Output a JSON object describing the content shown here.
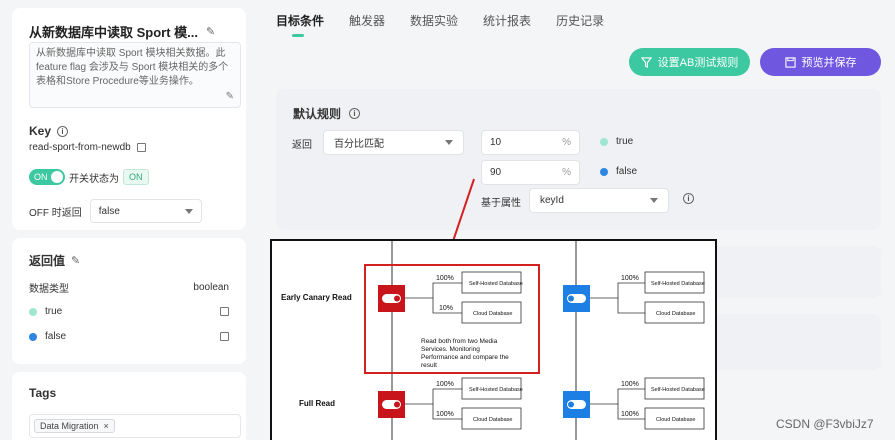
{
  "flag": {
    "title": "从新数据库中读取 Sport 模...",
    "description": "从新数据库中读取 Sport 模块相关数据。此 feature flag 会涉及与 Sport 模块相关的多个表格和Store Procedure等业务操作。",
    "key_label": "Key",
    "key_value": "read-sport-from-newdb",
    "switch_label": "ON",
    "switch_state_text": "开关状态为",
    "switch_state_tag": "ON",
    "off_return_label": "OFF 时返回",
    "off_return_value": "false"
  },
  "return_values": {
    "title": "返回值",
    "type_label": "数据类型",
    "type_value": "boolean",
    "items": [
      {
        "label": "true",
        "color": "#9fe6d0"
      },
      {
        "label": "false",
        "color": "#2f86e0"
      }
    ]
  },
  "tags": {
    "title": "Tags",
    "items": [
      "Data Migration"
    ]
  },
  "tabs": [
    "目标条件",
    "触发器",
    "数据实验",
    "统计报表",
    "历史记录"
  ],
  "buttons": {
    "ab": "设置AB测试规则",
    "save": "预览并保存"
  },
  "default_rule": {
    "title": "默认规则",
    "return_label": "返回",
    "mode": "百分比匹配",
    "pct_true": "10",
    "pct_false": "90",
    "pct_symbol": "%",
    "true_label": "true",
    "false_label": "false",
    "attr_label": "基于属性",
    "attr_value": "keyId"
  },
  "diagram": {
    "row1_label": "Early Canary Read",
    "row2_label": "Full Read",
    "db1": "Self-Hosted Database",
    "db2": "Cloud Database",
    "p100": "100%",
    "p10": "10%",
    "note": [
      "Read both from two Media",
      "Services. Monitoring",
      "Performance and compare the",
      "result"
    ]
  },
  "watermark": "CSDN @F3vbiJz7"
}
